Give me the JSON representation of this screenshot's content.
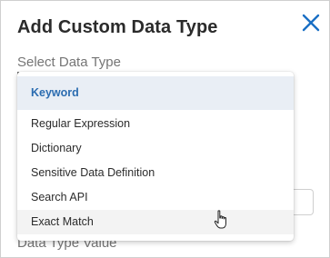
{
  "dialog": {
    "title": "Add Custom Data Type",
    "field_label": "Select Data Type",
    "obscured_label": "Data Type Value",
    "close_icon": "close-icon"
  },
  "dropdown": {
    "selected": "Keyword",
    "options": [
      "Keyword",
      "Regular Expression",
      "Dictionary",
      "Sensitive Data Definition",
      "Search API",
      "Exact Match"
    ],
    "hovered": "Exact Match"
  },
  "colors": {
    "accent": "#1a6fc4",
    "selected_bg": "#e9eef5",
    "hover_bg": "#f3f3f3"
  }
}
